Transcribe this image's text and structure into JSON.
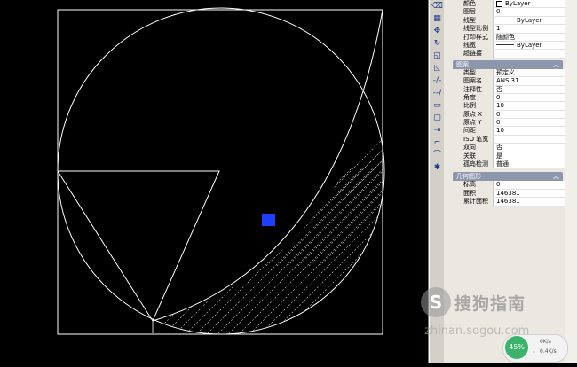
{
  "colors": {
    "canvas_bg": "#000000",
    "line": "#ffffff",
    "selection_grip": "#1f3fff",
    "section_header": "#8c96ac",
    "panel_bg": "#eae8e1"
  },
  "toolbar": {
    "icons": [
      "erase-icon",
      "array-icon",
      "move-icon",
      "rotate-icon",
      "scale-icon",
      "stretch-icon",
      "trim-icon",
      "extend-icon",
      "break-icon",
      "join-icon",
      "chamfer-icon",
      "fillet-icon",
      "explode-icon"
    ]
  },
  "properties": {
    "general": [
      {
        "key": "颜色",
        "value": "ByLayer",
        "swatch": true
      },
      {
        "key": "图层",
        "value": "0"
      },
      {
        "key": "线型",
        "value": "ByLayer",
        "line": true
      },
      {
        "key": "线型比例",
        "value": "1"
      },
      {
        "key": "打印样式",
        "value": "随颜色"
      },
      {
        "key": "线宽",
        "value": "ByLayer",
        "line": true
      },
      {
        "key": "超链接",
        "value": ""
      }
    ],
    "pattern_title": "图案",
    "pattern": [
      {
        "key": "类型",
        "value": "预定义"
      },
      {
        "key": "图案名",
        "value": "ANSI31"
      },
      {
        "key": "注释性",
        "value": "否"
      },
      {
        "key": "角度",
        "value": "0"
      },
      {
        "key": "比例",
        "value": "10"
      },
      {
        "key": "原点 X",
        "value": "0"
      },
      {
        "key": "原点 Y",
        "value": "0"
      },
      {
        "key": "间距",
        "value": "10"
      },
      {
        "key": "ISO 笔宽",
        "value": ""
      },
      {
        "key": "双向",
        "value": "否"
      },
      {
        "key": "关联",
        "value": "是"
      },
      {
        "key": "孤岛检测",
        "value": "普通"
      }
    ],
    "geometry_title": "几何图形",
    "geometry": [
      {
        "key": "标高",
        "value": "0"
      },
      {
        "key": "面积",
        "value": "146381"
      },
      {
        "key": "累计面积",
        "value": "146381"
      }
    ]
  },
  "watermark": {
    "title": "搜狗指南",
    "url": "zhinan.sogou.com",
    "icon_text": "S"
  },
  "net_widget": {
    "percent": "45%",
    "up": "0K/s",
    "down": "0.4K/s"
  }
}
